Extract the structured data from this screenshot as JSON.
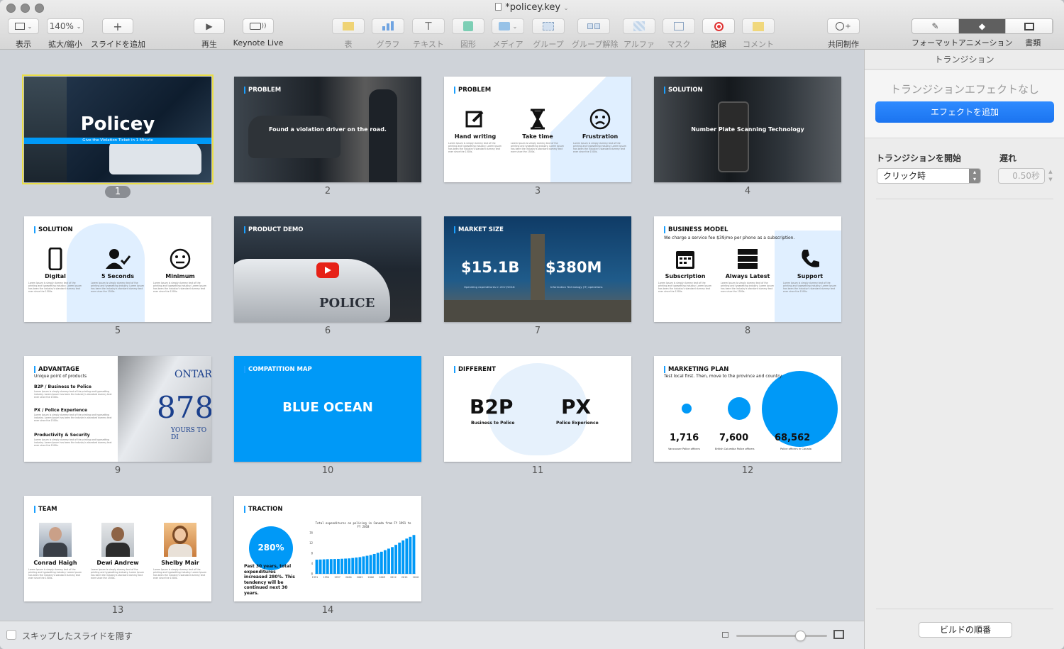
{
  "window": {
    "title": "*policey.key"
  },
  "toolbar": {
    "view": "表示",
    "zoom_value": "140%",
    "zoom": "拡大/縮小",
    "add_slide": "スライドを追加",
    "play": "再生",
    "keynote_live": "Keynote Live",
    "table": "表",
    "chart": "グラフ",
    "text": "テキスト",
    "shape": "図形",
    "media": "メディア",
    "group": "グループ",
    "ungroup": "グループ解除",
    "alpha": "アルファ",
    "mask": "マスク",
    "record": "記録",
    "comment": "コメント",
    "collaborate": "共同制作",
    "format": "フォーマット",
    "animate": "アニメーション",
    "document": "書類"
  },
  "slides": [
    {
      "n": "1",
      "title": "Policey",
      "subtitle": "Give the Violation Ticket in 1 Minute"
    },
    {
      "n": "2",
      "tag": "PROBLEM",
      "text": "Found a violation driver on the road."
    },
    {
      "n": "3",
      "tag": "PROBLEM",
      "cols": [
        "Hand writing",
        "Take time",
        "Frustration"
      ]
    },
    {
      "n": "4",
      "tag": "SOLUTION",
      "text": "Number Plate Scanning Technology"
    },
    {
      "n": "5",
      "tag": "SOLUTION",
      "cols": [
        "Digital",
        "5 Seconds",
        "Minimum"
      ]
    },
    {
      "n": "6",
      "tag": "PRODUCT DEMO",
      "overlay": "POLICE"
    },
    {
      "n": "7",
      "tag": "MARKET SIZE",
      "v1": "$15.1B",
      "v2": "$380M",
      "l1": "Operating expenditures in 2017/2018",
      "l2": "Information Technology (IT) operations"
    },
    {
      "n": "8",
      "tag": "BUSINESS MODEL",
      "text": "We charge a service fee $39/mo per phone as a subscription.",
      "cols": [
        "Subscription",
        "Always Latest",
        "Support"
      ]
    },
    {
      "n": "9",
      "tag": "ADVANTAGE",
      "text": "Unique point of products",
      "items": [
        "B2P / Business to Police",
        "PX / Police Experience",
        "Productivity & Security"
      ],
      "plate": "878",
      "plate_top": "ONTAR",
      "plate_bottom": "YOURS TO DI"
    },
    {
      "n": "10",
      "tag": "COMPATITION MAP",
      "text": "BLUE OCEAN"
    },
    {
      "n": "11",
      "tag": "DIFFERENT",
      "v1": "B2P",
      "v2": "PX",
      "l1": "Business to Police",
      "l2": "Police Experience"
    },
    {
      "n": "12",
      "tag": "MARKETING PLAN",
      "text": "Test local first. Then, move to the province and country.",
      "vals": [
        "1,716",
        "7,600",
        "68,562"
      ],
      "labels": [
        "Vancouver Police officers",
        "British Columbia Police officers",
        "Police officers in Canada"
      ]
    },
    {
      "n": "13",
      "tag": "TEAM",
      "people": [
        "Conrad Haigh",
        "Dewi Andrew",
        "Shelby Mair"
      ]
    },
    {
      "n": "14",
      "tag": "TRACTION",
      "big": "280%",
      "text": "Past 30 years, total expenditures increased 280%. This tendency will be continued next 30 years.",
      "chart_title": "Total expenditures on policing in Canada from FY 1991 to FY 2018"
    }
  ],
  "lorem": "Lorem Ipsum is simply dummy text of the printing and typesetting industry. Lorem Ipsum has been the industry's standard dummy text ever since the 1500s.",
  "status": {
    "hide_skipped": "スキップしたスライドを隠す",
    "zoom_level": 0.7
  },
  "inspector": {
    "header": "トランジション",
    "none": "トランジションエフェクトなし",
    "add_effect": "エフェクトを追加",
    "start_label": "トランジションを開始",
    "delay_label": "遅れ",
    "start_value": "クリック時",
    "delay_value": "0.50秒",
    "build_order": "ビルドの順番"
  },
  "chart_data": {
    "type": "bar",
    "title": "Total expenditures on policing in Canada from FY 1991 to FY 2018",
    "categories": [
      "1991",
      "1994",
      "1997",
      "2000",
      "2003",
      "2006",
      "2009",
      "2012",
      "2015",
      "2018"
    ],
    "values": [
      5.5,
      5.7,
      5.8,
      6.0,
      6.5,
      7.3,
      8.6,
      10.4,
      13.0,
      15.1
    ],
    "ylim": [
      0,
      16
    ],
    "yticks": [
      "16",
      "12",
      "8",
      "4",
      "0"
    ]
  },
  "colors": {
    "accent": "#0099f7",
    "selection": "#e9dd47"
  }
}
